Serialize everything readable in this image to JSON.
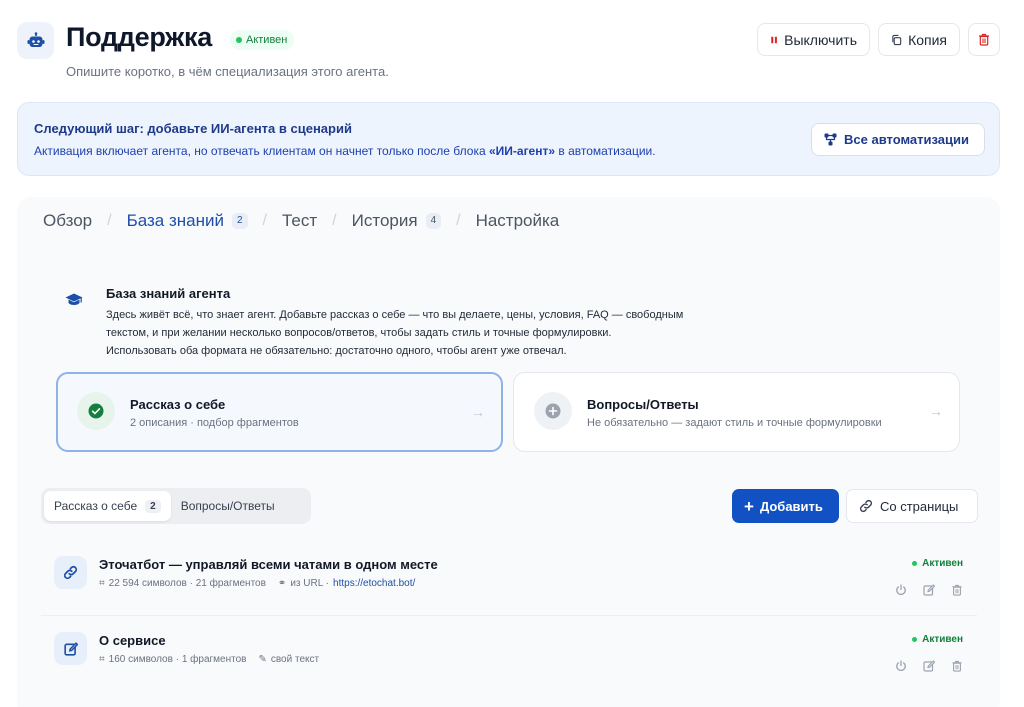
{
  "header": {
    "title": "Поддержка",
    "status": "Активен",
    "description": "Опишите коротко, в чём специализация этого агента.",
    "buttons": {
      "disable": "Выключить",
      "copy": "Копия"
    }
  },
  "banner": {
    "title": "Следующий шаг: добавьте ИИ-агента в сценарий",
    "text_before": "Активация включает агента, но отвечать клиентам он начнет только после блока ",
    "text_bold": "«ИИ-агент»",
    "text_after": " в автоматизации.",
    "button": "Все автоматизации"
  },
  "tabs": [
    {
      "label": "Обзор",
      "count": ""
    },
    {
      "label": "База знаний",
      "count": "2"
    },
    {
      "label": "Тест",
      "count": ""
    },
    {
      "label": "История",
      "count": "4"
    },
    {
      "label": "Настройка",
      "count": ""
    }
  ],
  "knowledge": {
    "title": "База знаний агента",
    "desc_lines": [
      "Здесь живёт всё, что знает агент. Добавьте рассказ о себе — что вы делаете, цены, условия, FAQ — свободным",
      "текстом, и при желании несколько вопросов/ответов, чтобы задать стиль и точные формулировки.",
      "Использовать оба формата не обязательно: достаточно одного, чтобы агент уже отвечал."
    ],
    "cards": [
      {
        "title": "Рассказ о себе",
        "subtitle": "2 описания · подбор фрагментов"
      },
      {
        "title": "Вопросы/Ответы",
        "subtitle": "Не обязательно — задают стиль и точные формулировки"
      }
    ]
  },
  "segment": {
    "items": [
      {
        "label": "Рассказ о себе",
        "count": "2"
      },
      {
        "label": "Вопросы/Ответы",
        "count": ""
      }
    ]
  },
  "actions": {
    "add": "Добавить",
    "from_page": "Со страницы"
  },
  "rows": [
    {
      "title": "Эточатбот — управляй всеми чатами в одном месте",
      "stats": "22 594 символов · 21 фрагментов",
      "source_label": "из URL ·",
      "source_link": "https://etochat.bot/",
      "status": "Активен"
    },
    {
      "title": "О сервисе",
      "stats": "160 символов · 1 фрагментов",
      "source_label": "свой текст",
      "source_link": "",
      "status": "Активен"
    }
  ],
  "colors": {
    "accent": "#1251c4",
    "active_status": "#15803d",
    "danger": "#dc2626"
  }
}
